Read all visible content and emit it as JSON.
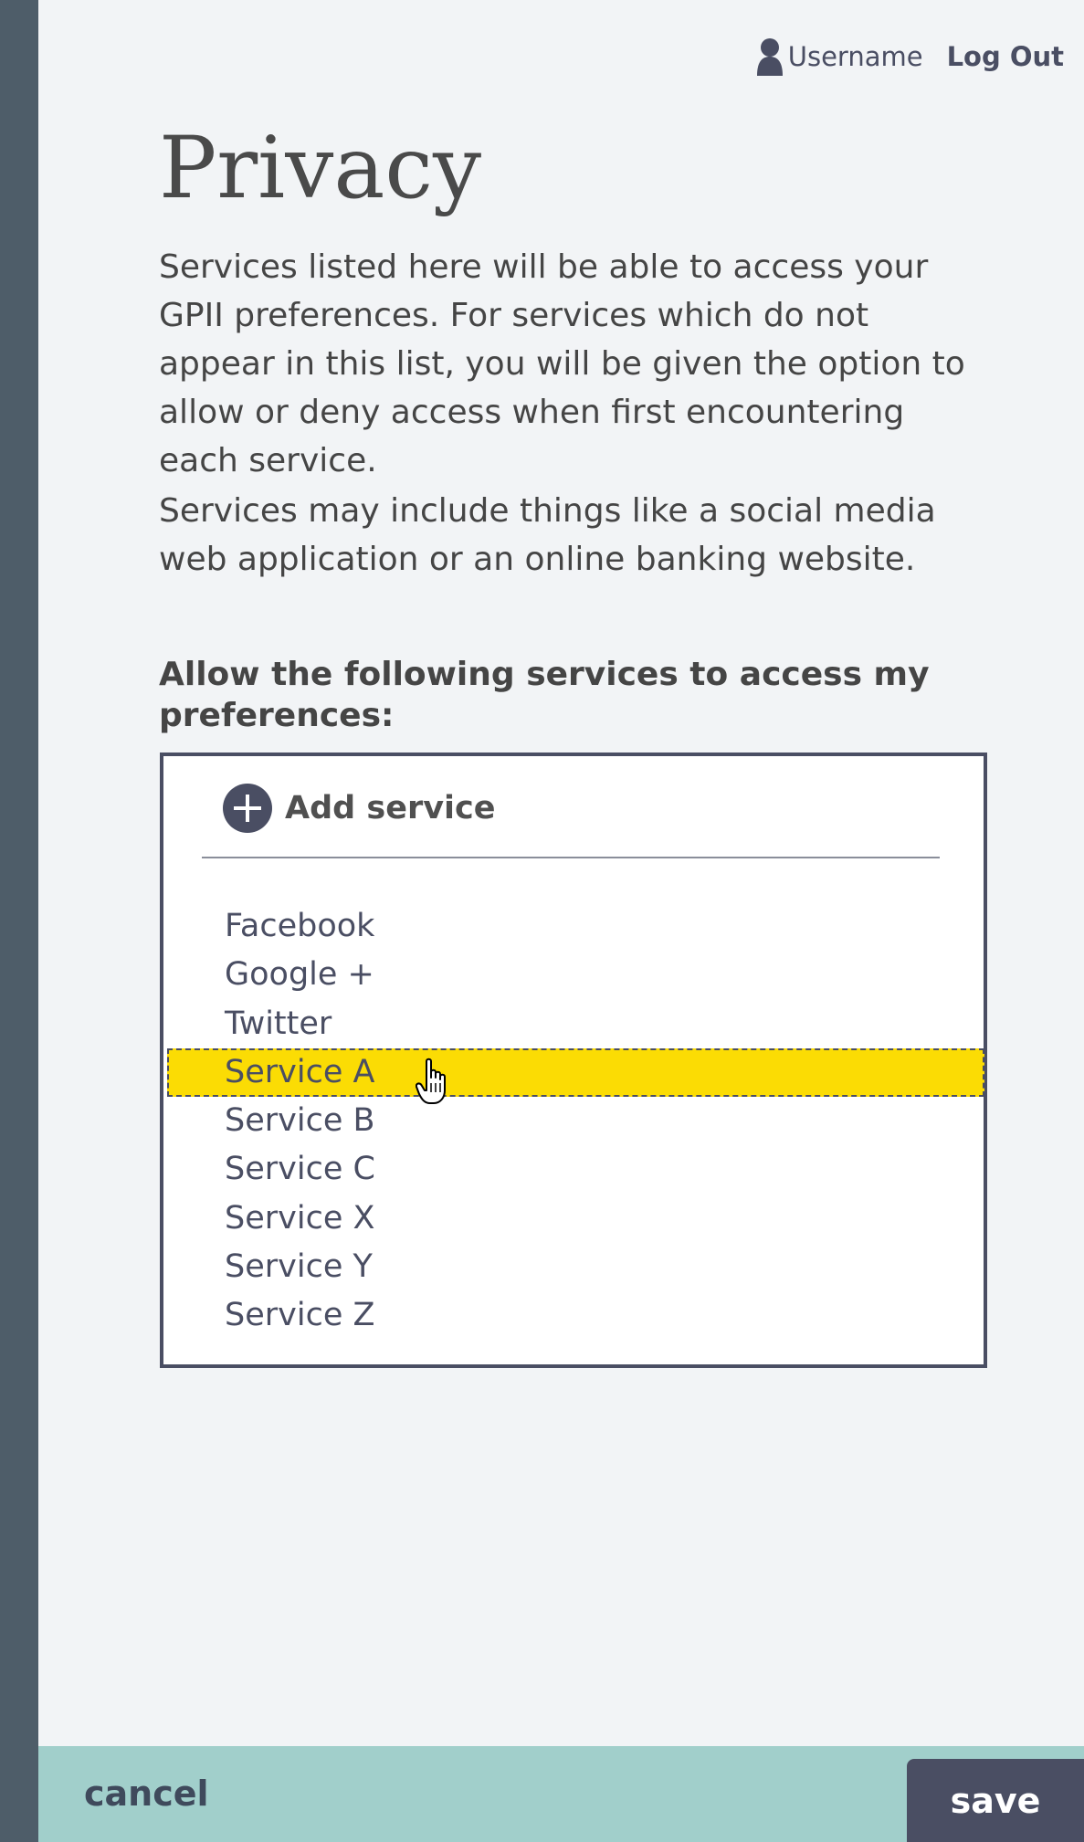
{
  "header": {
    "username": "Username",
    "logout_label": "Log Out"
  },
  "page": {
    "title": "Privacy",
    "intro": "Services listed here will be able to access your GPII preferences. For services which do not appear in this list, you will be given the option to allow or deny access when first encountering each service.",
    "intro2": "Services may include things like a social media web application or an online banking website.",
    "allow_label": "Allow the following services to access my preferences:"
  },
  "services_panel": {
    "add_label": "Add service",
    "items": [
      {
        "label": "Facebook",
        "selected": false
      },
      {
        "label": "Google +",
        "selected": false
      },
      {
        "label": "Twitter",
        "selected": false
      },
      {
        "label": "Service A",
        "selected": true
      },
      {
        "label": "Service B",
        "selected": false
      },
      {
        "label": "Service C",
        "selected": false
      },
      {
        "label": "Service X",
        "selected": false
      },
      {
        "label": "Service Y",
        "selected": false
      },
      {
        "label": "Service Z",
        "selected": false
      }
    ],
    "highlight_color": "#fbdc04"
  },
  "footer": {
    "cancel_label": "cancel",
    "save_label": "save"
  },
  "colors": {
    "sidebar": "#4e5d69",
    "accent_dark": "#4a4e63",
    "footer_bg": "#a1cfcb"
  }
}
